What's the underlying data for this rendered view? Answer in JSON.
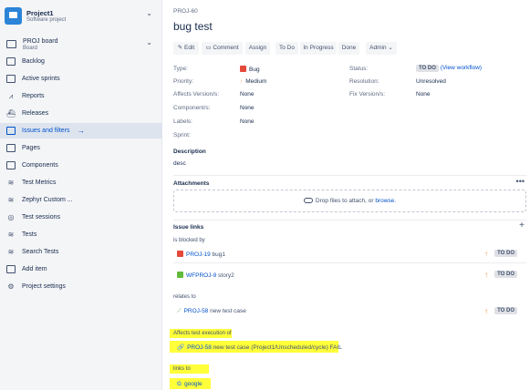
{
  "sidebar": {
    "project": {
      "name": "Project1",
      "type": "Software project"
    },
    "board": {
      "name": "PROJ board",
      "sub": "Board"
    },
    "items": [
      {
        "label": "Backlog",
        "icon": "backlog-icon"
      },
      {
        "label": "Active sprints",
        "icon": "sprint-icon"
      },
      {
        "label": "Reports",
        "icon": "chart-icon"
      },
      {
        "label": "Releases",
        "icon": "ship-icon"
      },
      {
        "label": "Issues and filters",
        "icon": "issues-icon",
        "active": true
      },
      {
        "label": "Pages",
        "icon": "page-icon"
      },
      {
        "label": "Components",
        "icon": "components-icon"
      },
      {
        "label": "Test Metrics",
        "icon": "zephyr-icon"
      },
      {
        "label": "Zephyr Custom ...",
        "icon": "zephyr-icon"
      },
      {
        "label": "Test sessions",
        "icon": "session-icon"
      },
      {
        "label": "Tests",
        "icon": "zephyr-icon"
      },
      {
        "label": "Search Tests",
        "icon": "zephyr-icon"
      },
      {
        "label": "Add item",
        "icon": "add-icon"
      },
      {
        "label": "Project settings",
        "icon": "gear-icon"
      }
    ]
  },
  "issue": {
    "key": "PROJ-60",
    "title": "bug test"
  },
  "toolbar": {
    "edit": "Edit",
    "comment": "Comment",
    "assign": "Assign",
    "todo": "To Do",
    "inprogress": "In Progress",
    "done": "Done",
    "admin": "Admin"
  },
  "fields": {
    "type_label": "Type:",
    "type_value": "Bug",
    "priority_label": "Priority:",
    "priority_value": "Medium",
    "affects_label": "Affects Version/s:",
    "affects_value": "None",
    "components_label": "Component/s:",
    "components_value": "None",
    "labels_label": "Labels:",
    "labels_value": "None",
    "sprint_label": "Sprint:",
    "status_label": "Status:",
    "status_value": "TO DO",
    "status_link": "(View workflow)",
    "resolution_label": "Resolution:",
    "resolution_value": "Unresolved",
    "fix_label": "Fix Version/s:",
    "fix_value": "None"
  },
  "description": {
    "heading": "Description",
    "text": "desc"
  },
  "attachments": {
    "heading": "Attachments",
    "drop_text": "Drop files to attach, or ",
    "browse": "browse."
  },
  "issue_links": {
    "heading": "Issue links",
    "groups": [
      {
        "relation": "is blocked by",
        "links": [
          {
            "key": "PROJ-19",
            "summary": "bug1",
            "type": "bug",
            "status": "TO DO"
          },
          {
            "key": "WFPROJ-9",
            "summary": "story2",
            "type": "story",
            "status": "TO DO"
          }
        ]
      },
      {
        "relation": "relates to",
        "links": [
          {
            "key": "PROJ-58",
            "summary": "new test case",
            "type": "test",
            "status": "TO DO"
          }
        ]
      }
    ],
    "affects_execution": {
      "relation": "Affects test execution of",
      "key": "PROJ-58",
      "summary": "new test case (Project1/Unscheduled/cycle) FAIL"
    },
    "links_to": {
      "relation": "links to",
      "text": "google"
    }
  },
  "colors": {
    "accent": "#0052cc",
    "highlight": "#ffff3a",
    "bug": "#e5493a",
    "story": "#63ba3c"
  }
}
